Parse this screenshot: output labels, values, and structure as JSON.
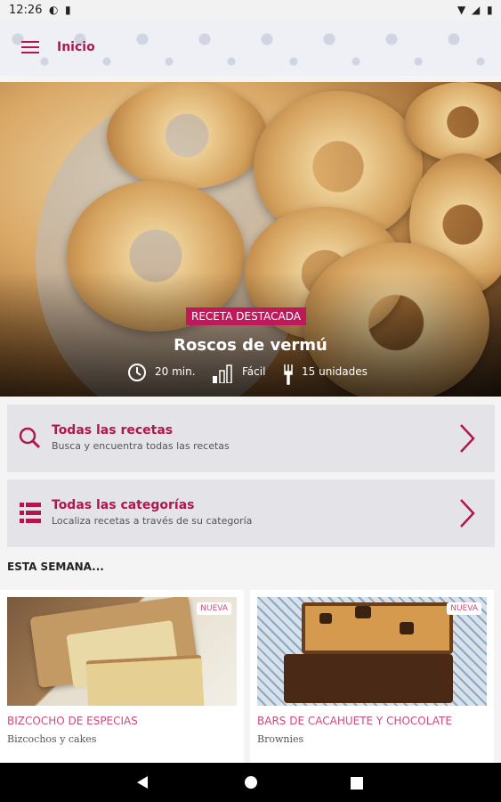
{
  "status_bar": {
    "time": "12:26"
  },
  "app_bar": {
    "title": "Inicio"
  },
  "featured": {
    "badge": "RECETA DESTACADA",
    "title": "Roscos de vermú",
    "time": "20 min.",
    "difficulty": "Fácil",
    "servings": "15 unidades"
  },
  "nav_cards": [
    {
      "title": "Todas las recetas",
      "subtitle": "Busca y encuentra todas las recetas"
    },
    {
      "title": "Todas las categorías",
      "subtitle": "Localiza recetas a través de su categoría"
    }
  ],
  "section": {
    "title": "ESTA SEMANA..."
  },
  "recipes": [
    {
      "badge": "NUEVA",
      "name": "BIZCOCHO DE ESPECIAS",
      "category": "Bizcochos y cakes"
    },
    {
      "badge": "NUEVA",
      "name": "BARS DE CACAHUETE Y CHOCOLATE",
      "category": "Brownies"
    }
  ],
  "colors": {
    "brand": "#b0174f",
    "badge": "#c0185a",
    "recipe_name": "#d04978"
  }
}
